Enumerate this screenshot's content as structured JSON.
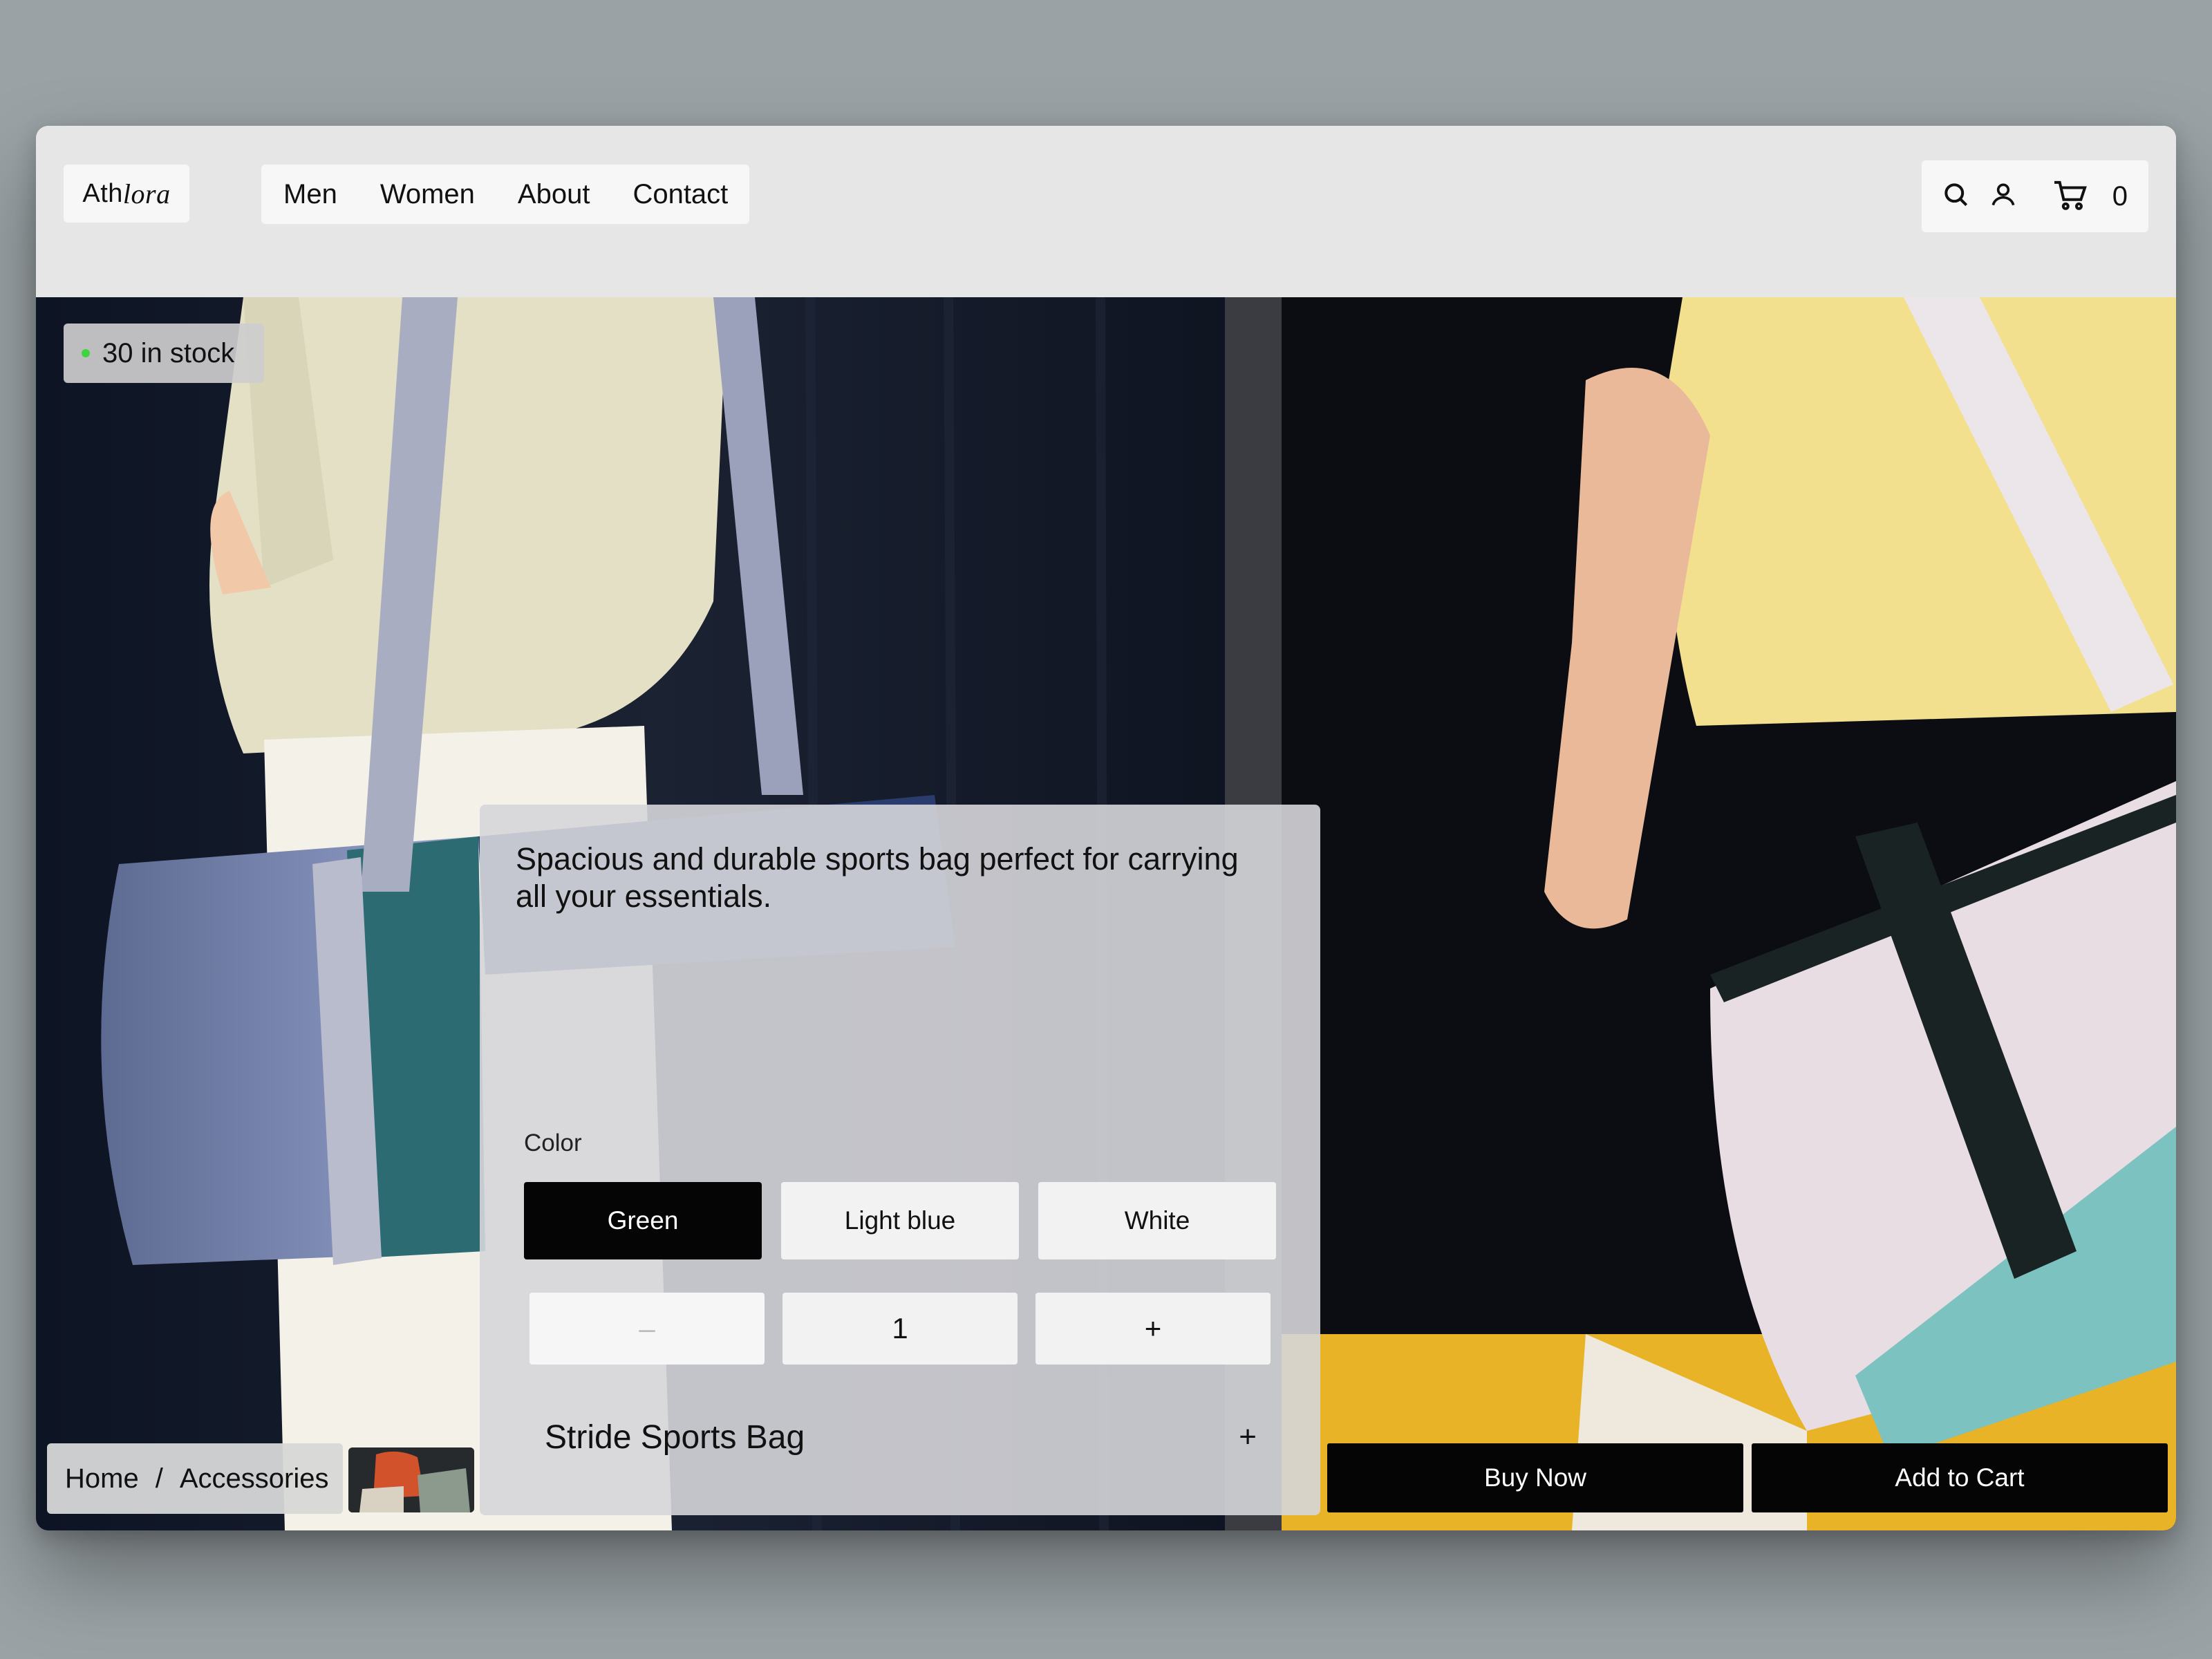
{
  "header": {
    "logo_bold": "Ath",
    "logo_italic": "lora",
    "nav": [
      "Men",
      "Women",
      "About",
      "Contact"
    ],
    "cart_count": "0",
    "icons": [
      "search-icon",
      "user-icon",
      "cart-icon"
    ]
  },
  "stock": {
    "label": "30 in stock",
    "status_color": "#3fd43f"
  },
  "product": {
    "description": "Spacious and durable sports bag perfect for carrying all your essentials.",
    "color_label": "Color",
    "colors": [
      "Green",
      "Light blue",
      "White"
    ],
    "selected_color": "Green",
    "quantity": {
      "minus": "–",
      "value": "1",
      "plus": "+"
    },
    "name": "Stride Sports Bag",
    "expand": "+"
  },
  "breadcrumb": {
    "home": "Home",
    "separator": "/",
    "category": "Accessories"
  },
  "actions": {
    "buy_now": "Buy Now",
    "add_to_cart": "Add to Cart"
  },
  "colors": {
    "accent": "#050505",
    "panel": "#d6d6da",
    "background": "#9aa2a5"
  }
}
